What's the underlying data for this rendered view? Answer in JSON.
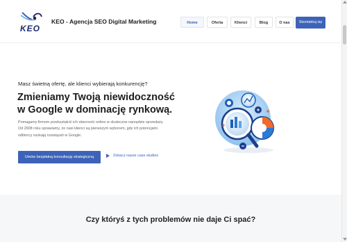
{
  "header": {
    "logo_text": "KEO",
    "site_title": "KEO - Agencja SEO Digital Marketing",
    "nav": [
      "Home",
      "Oferta",
      "Klienci",
      "Blog",
      "O nas"
    ],
    "cta": "Skontaktuj się"
  },
  "hero": {
    "eyebrow": "Masz świetną ofertę, ale klienci wybierają konkurencję?",
    "headline": "Zmieniamy Twoją niewidoczność w Google w dominację rynkową.",
    "description": "Pomagamy firmom przekształcić ich obecność online w skuteczne narzędzie sprzedaży. Od 2008 roku sprawiamy, że nasi klienci są pierwszym wyborem, gdy ich potencjalni odbiorcy szukają rozwiązań w Google.",
    "primary_cta": "Umów bezpłatną konsultację strategiczną",
    "secondary_cta": "Zobacz nasze case studies"
  },
  "section2": {
    "title": "Czy któryś z tych problemów nie daje Ci spać?"
  },
  "colors": {
    "accent": "#3d63b8",
    "band": "#f6f7f9"
  },
  "icons": {
    "play": "play-icon",
    "illustration": "seo-analytics-illustration"
  }
}
